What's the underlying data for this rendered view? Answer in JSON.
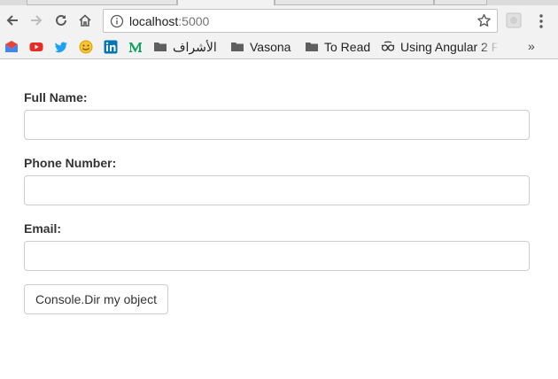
{
  "browser": {
    "url_host": "localhost",
    "url_port": ":5000",
    "bookmarks": [
      {
        "icon": "inbox-icon",
        "label": ""
      },
      {
        "icon": "youtube-icon",
        "label": ""
      },
      {
        "icon": "twitter-icon",
        "label": ""
      },
      {
        "icon": "emoji-icon",
        "label": ""
      },
      {
        "icon": "linkedin-icon",
        "label": ""
      },
      {
        "icon": "medium-icon",
        "label": ""
      },
      {
        "icon": "folder-icon",
        "label": "الأشراف"
      },
      {
        "icon": "folder-icon",
        "label": "Vasona"
      },
      {
        "icon": "folder-icon",
        "label": "To Read"
      },
      {
        "icon": "glasses-icon",
        "label": "Using Angular 2 F"
      }
    ],
    "overflow_label": "»"
  },
  "form": {
    "full_name_label": "Full Name:",
    "full_name_value": "",
    "phone_label": "Phone Number:",
    "phone_value": "",
    "email_label": "Email:",
    "email_value": "",
    "submit_label": "Console.Dir my object"
  },
  "colors": {
    "chrome_bg": "#f2f2f2",
    "youtube": "#e52d27",
    "twitter": "#1da1f2",
    "linkedin": "#0077b5",
    "medium": "#12a55f"
  }
}
